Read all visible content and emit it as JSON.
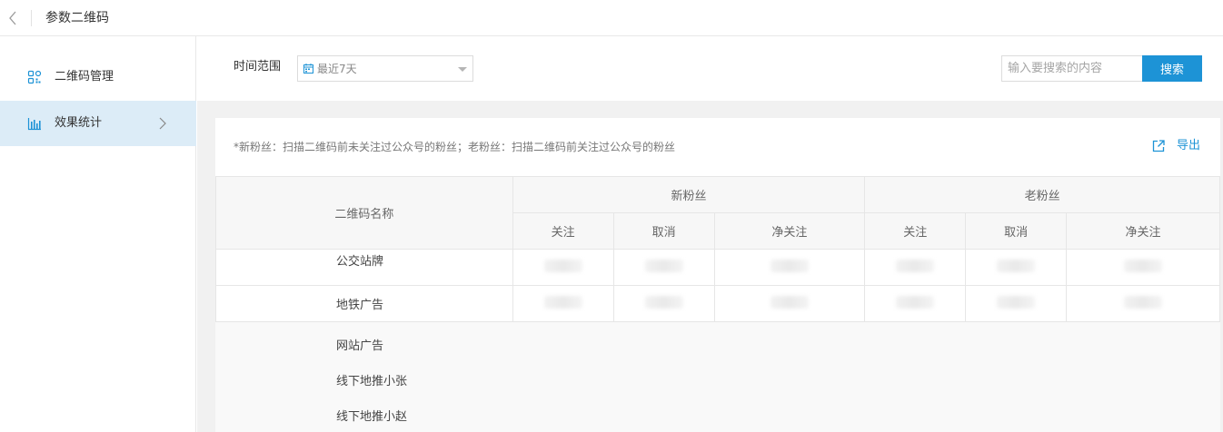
{
  "header": {
    "title": "参数二维码"
  },
  "sidebar": {
    "items": [
      {
        "label": "二维码管理",
        "icon": "qrcode-icon",
        "active": false
      },
      {
        "label": "效果统计",
        "icon": "bar-chart-icon",
        "active": true
      }
    ]
  },
  "filter": {
    "range_label": "时间范围",
    "range_value": "最近7天"
  },
  "search": {
    "placeholder": "输入要搜索的内容",
    "button_label": "搜索"
  },
  "card": {
    "note": "*新粉丝：扫描二维码前未关注过公众号的粉丝；老粉丝：扫描二维码前关注过公众号的粉丝",
    "export_label": "导出"
  },
  "table": {
    "name_header": "二维码名称",
    "groups": [
      "新粉丝",
      "老粉丝"
    ],
    "sub_headers": [
      "关注",
      "取消",
      "净关注",
      "关注",
      "取消",
      "净关注"
    ],
    "rows": [
      "公交站牌",
      "地铁广告"
    ],
    "extra_rows": [
      "网站广告",
      "线下地推小张",
      "线下地推小赵"
    ]
  },
  "colors": {
    "accent": "#1d93d6",
    "sidebar_active_bg": "#dcecf7",
    "main_bg": "#f1f1f1"
  }
}
